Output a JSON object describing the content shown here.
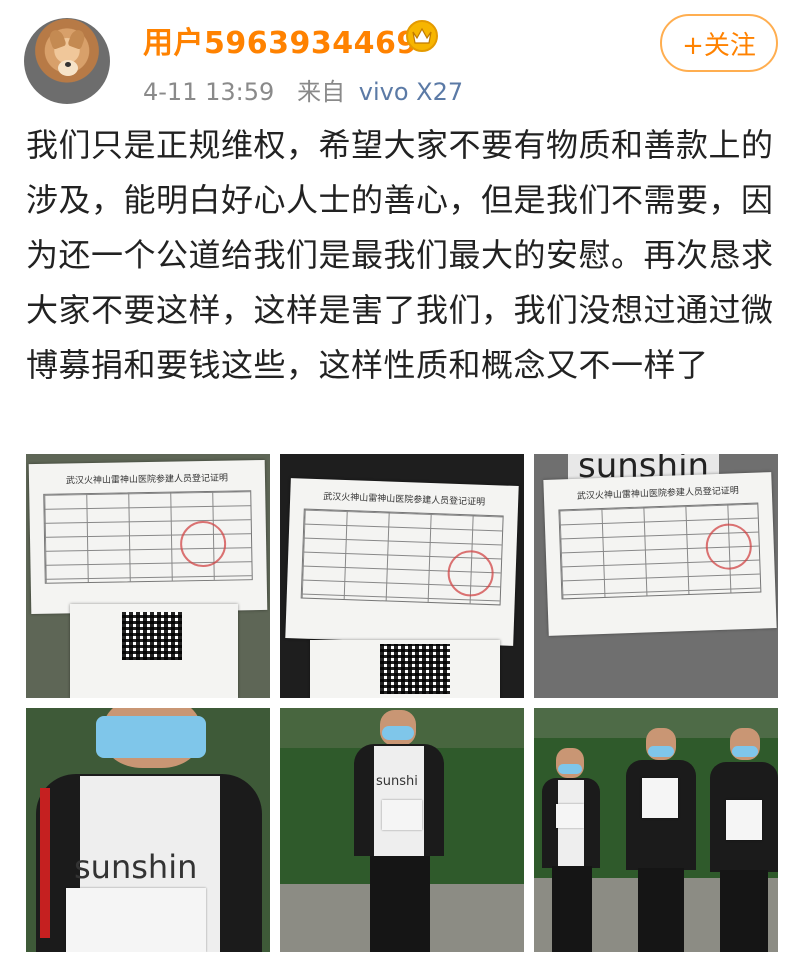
{
  "user": {
    "name": "用户5963934469",
    "badge_icon": "crown-icon",
    "avatar_icon": "shiba-dog-avatar"
  },
  "meta": {
    "time": "4-11 13:59",
    "source_prefix": "来自",
    "source": "vivo X27"
  },
  "follow_button": {
    "label": "+关注"
  },
  "post": {
    "text": "我们只是正规维权，希望大家不要有物质和善款上的涉及，能明白好心人士的善心，但是我们不需要，因为还一个公道给我们是最我们最大的安慰。再次恳求大家不要这样，这样是害了我们，我们没想过通过微博募捐和要钱这些，这样性质和概念又不一样了"
  },
  "photos": {
    "doc_title": "武汉火神山雷神山医院参建人员登记证明",
    "shirt_text_1": "sunshin",
    "shirt_text_2": "sunshi",
    "banner_text": "sunshin"
  },
  "colors": {
    "username": "#ff8200",
    "follow_border": "#ffae50",
    "meta": "#8a8a8a",
    "source": "#5b7aa6"
  }
}
